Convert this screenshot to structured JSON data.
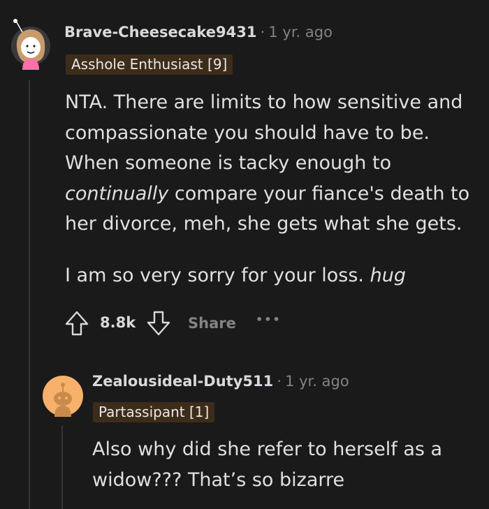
{
  "comments": [
    {
      "username": "Brave-Cheesecake9431",
      "separator": "·",
      "time": "1 yr. ago",
      "flair": "Asshole Enthusiast [9]",
      "body_lines": [
        "NTA. There are limits to how sensitive and",
        "compassionate you should have to be.",
        "When someone is tacky enough to",
        "compare your fiance's death to",
        "her divorce, meh, she gets what she gets."
      ],
      "italic_word": "continually",
      "line2_prefix": "I am so very sorry for your loss.",
      "line2_italic": "hug",
      "score": "8.8k",
      "share_label": "Share",
      "more_label": "•••",
      "avatar_color": "#ffffff"
    },
    {
      "username": "Zealousideal-Duty511",
      "separator": "·",
      "time": "1 yr. ago",
      "flair": "Partassipant [1]",
      "body_lines": [
        "Also why did she refer to herself as a",
        "widow??? That’s so bizarre"
      ],
      "avatar_color": "#f7b16a"
    }
  ]
}
